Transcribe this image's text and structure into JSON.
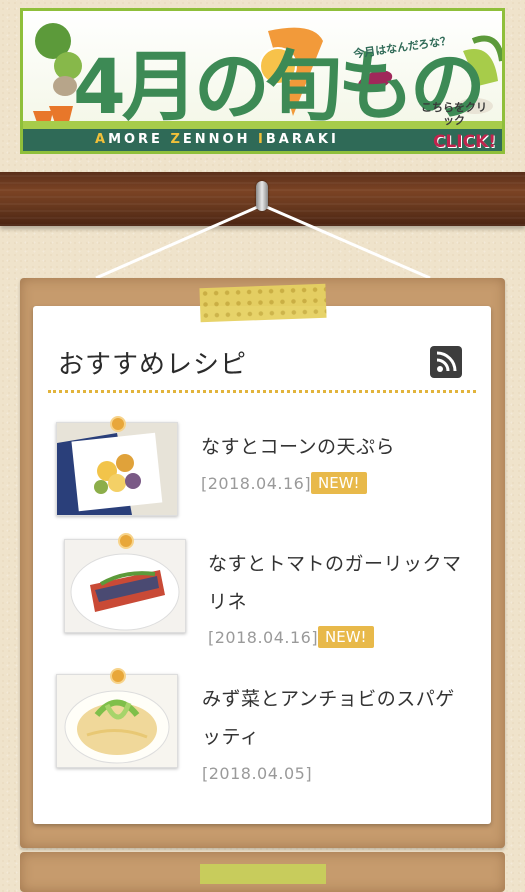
{
  "banner": {
    "title": "4月の旬もの",
    "subtitle": "今月はなんだろな？",
    "caption_parts": [
      "A",
      "MORE ",
      "Z",
      "ENNOH ",
      "I",
      "BARAKI"
    ],
    "cta": "こちらをクリック",
    "click": "CLICK!"
  },
  "section": {
    "title": "おすすめレシピ",
    "rss_icon": "rss-icon"
  },
  "recipes": [
    {
      "title_lines": [
        "なすとコーンの天ぷら"
      ],
      "date": "[2018.04.16]",
      "badge": "NEW!"
    },
    {
      "title_lines": [
        "なすとトマトのガーリックマ",
        "リネ"
      ],
      "date": "[2018.04.16]",
      "badge": "NEW!"
    },
    {
      "title_lines": [
        "みず菜とアンチョビのスパゲ",
        "ッティ"
      ],
      "date": "[2018.04.05]",
      "badge": null
    }
  ],
  "colors": {
    "accent": "#e8b94a",
    "banner_green": "#3d8a55",
    "wood": "#6b3a1f",
    "board": "#c69b6d"
  }
}
